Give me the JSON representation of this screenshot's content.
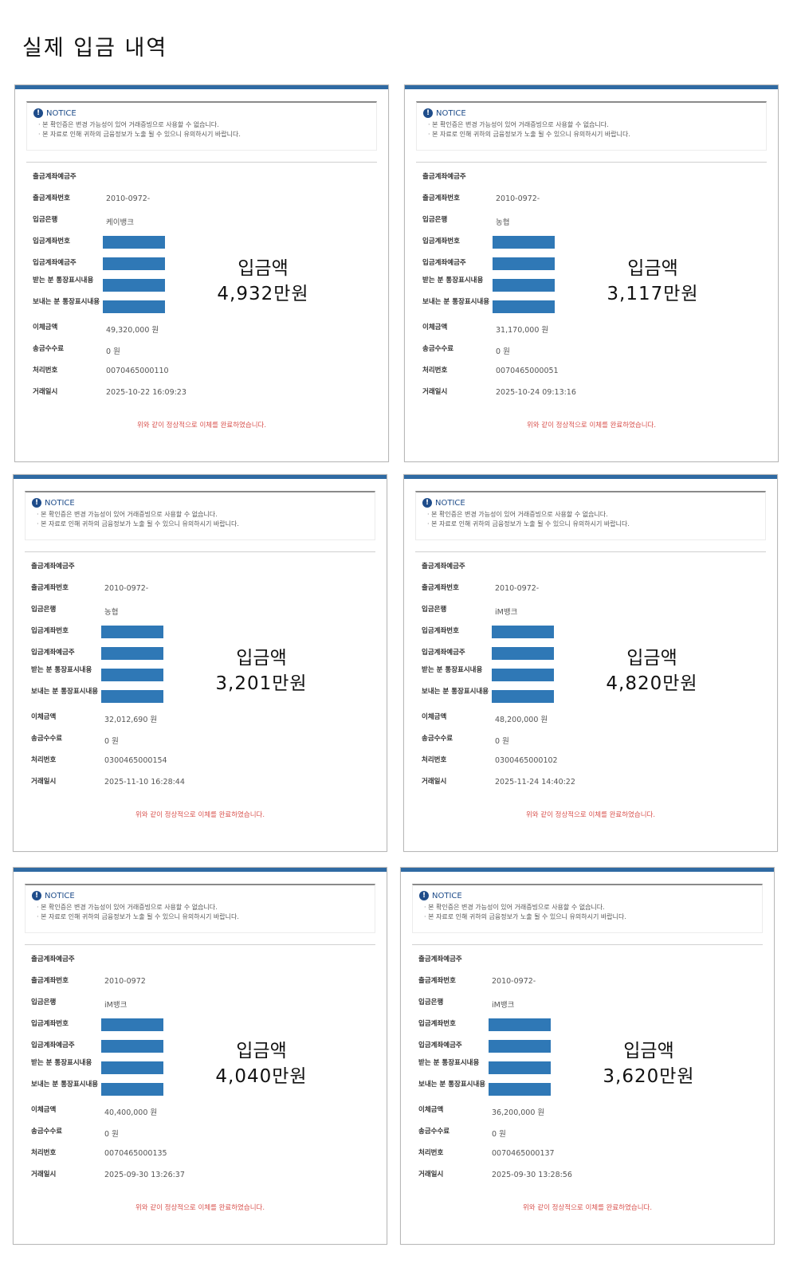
{
  "page_title": "실제 입금 내역",
  "notice": {
    "label": "NOTICE",
    "line1": "본 확인증은 변경 가능성이 있어 거래증빙으로 사용할 수 없습니다.",
    "line2": "본 자료로 인해 귀하의 금융정보가 노출 될 수 있으니 유의하시기 바랍니다."
  },
  "labels": {
    "owner": "출금계좌예금주",
    "out_account": "출금계좌번호",
    "bank": "입금은행",
    "in_account": "입금계좌번호",
    "in_owner": "입금계좌예금주",
    "receiver_memo": "받는 분 통장표시내용",
    "sender_memo": "보내는 분 통장표시내용",
    "amount": "이체금액",
    "fee": "송금수수료",
    "proc_no": "처리번호",
    "datetime": "거래일시"
  },
  "completion_message": "위와 같이 정상적으로 이체를 완료하였습니다.",
  "big_label": "입금액",
  "colors": {
    "topbar": "#2f6aa3",
    "mask": "#2f78b6",
    "message": "#d9534f"
  },
  "receipts": [
    {
      "out_account": "2010-0972-",
      "bank": "케이뱅크",
      "amount": "49,320,000 원",
      "fee": "0 원",
      "proc_no": "0070465000110",
      "datetime": "2025-10-22 16:09:23",
      "big_amount": "4,932만원"
    },
    {
      "out_account": "2010-0972-",
      "bank": "농협",
      "amount": "31,170,000 원",
      "fee": "0 원",
      "proc_no": "0070465000051",
      "datetime": "2025-10-24 09:13:16",
      "big_amount": "3,117만원"
    },
    {
      "out_account": "2010-0972-",
      "bank": "농협",
      "amount": "32,012,690 원",
      "fee": "0 원",
      "proc_no": "0300465000154",
      "datetime": "2025-11-10 16:28:44",
      "big_amount": "3,201만원"
    },
    {
      "out_account": "2010-0972-",
      "bank": "iM뱅크",
      "amount": "48,200,000 원",
      "fee": "0 원",
      "proc_no": "0300465000102",
      "datetime": "2025-11-24 14:40:22",
      "big_amount": "4,820만원"
    },
    {
      "out_account": "2010-0972",
      "bank": "iM뱅크",
      "amount": "40,400,000 원",
      "fee": "0 원",
      "proc_no": "0070465000135",
      "datetime": "2025-09-30 13:26:37",
      "big_amount": "4,040만원"
    },
    {
      "out_account": "2010-0972-",
      "bank": "iM뱅크",
      "amount": "36,200,000 원",
      "fee": "0 원",
      "proc_no": "0070465000137",
      "datetime": "2025-09-30 13:28:56",
      "big_amount": "3,620만원"
    }
  ]
}
